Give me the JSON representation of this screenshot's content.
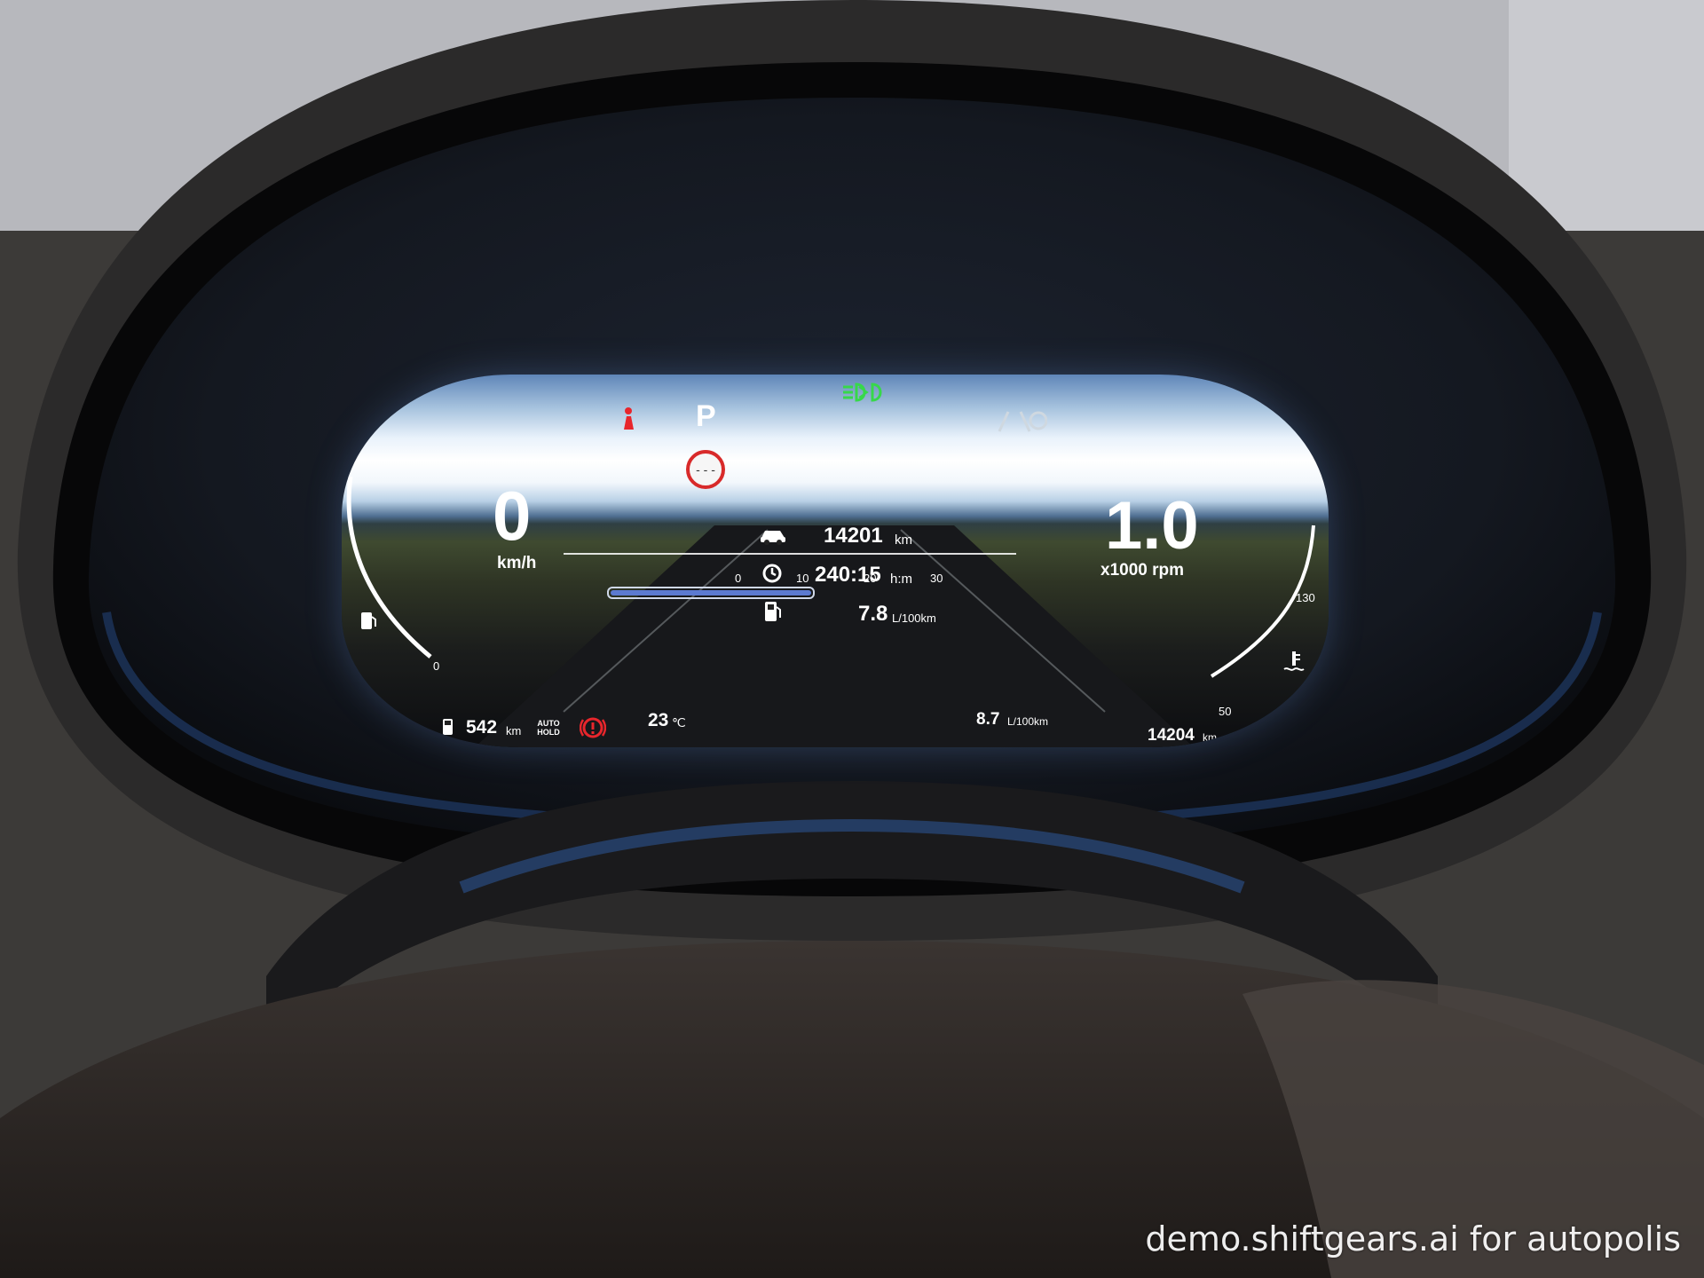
{
  "gear": "P",
  "speed": {
    "value": "0",
    "unit": "km/h"
  },
  "rpm": {
    "value": "1.0",
    "unit": "x1000 rpm"
  },
  "trip_info": {
    "odometer_trip": {
      "value": "14201",
      "unit": "km"
    },
    "drive_time": {
      "value": "240:15",
      "unit": "h:m"
    },
    "avg_consumption": {
      "value": "7.8",
      "unit": "L/100km"
    }
  },
  "bottom_bar": {
    "range": {
      "value": "542",
      "unit": "km"
    },
    "auto_hold": "AUTO HOLD",
    "outside_temp": {
      "value": "23",
      "unit": "℃"
    },
    "consumption_scale": [
      "0",
      "10",
      "20",
      "30"
    ],
    "instant_consumption": {
      "value": "8.7",
      "unit": "L/100km"
    },
    "odometer_total": {
      "value": "14204",
      "unit": "km"
    }
  },
  "fuel_gauge_ticks": {
    "low": "0"
  },
  "temp_gauge_ticks": {
    "high": "130",
    "low": "50"
  },
  "watermark": "demo.shiftgears.ai for autopolis",
  "colors": {
    "indicator_green": "#37d84a",
    "warning_red": "#e8262c",
    "gauge_white": "#ffffff"
  },
  "icons": [
    "low-beam-headlight-icon",
    "seatbelt-warning-icon",
    "speed-limit-sign-icon",
    "lane-assist-icon",
    "car-icon",
    "clock-icon",
    "fuel-pump-icon",
    "coolant-temperature-icon",
    "brake-warning-icon"
  ]
}
